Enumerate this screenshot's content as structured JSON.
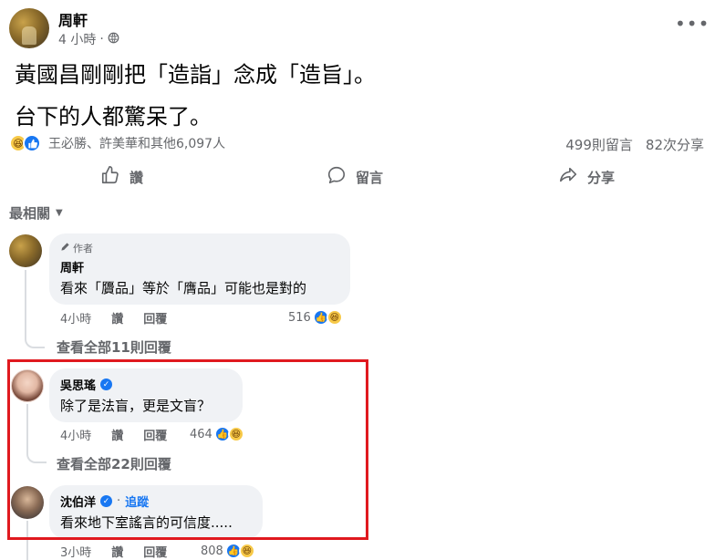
{
  "post": {
    "author": "周軒",
    "time": "4 小時",
    "meta_sep": "·",
    "line1": "黃國昌剛剛把「造詣」念成「造旨」。",
    "line2": "台下的人都驚呆了。",
    "reactors": "王必勝、許美華和其他6,097人",
    "comment_count": "499則留言",
    "share_count": "82次分享"
  },
  "actions": {
    "like": "讚",
    "comment": "留言",
    "share": "分享"
  },
  "sort_label": "最相關",
  "comments": [
    {
      "author_tag": "作者",
      "name": "周軒",
      "text": "看來「贗品」等於「膺品」可能也是對的",
      "time": "4小時",
      "like_label": "讚",
      "reply_label": "回覆",
      "reactions": "516",
      "view_replies": "查看全部11則回覆"
    },
    {
      "name": "吳思瑤",
      "text": "除了是法盲，更是文盲？",
      "time": "4小時",
      "like_label": "讚",
      "reply_label": "回覆",
      "reactions": "464",
      "view_replies": "查看全部22則回覆"
    },
    {
      "name": "沈伯洋",
      "follow": "追蹤",
      "text": "看來地下室謠言的可信度.....",
      "time": "3小時",
      "like_label": "讚",
      "reply_label": "回覆",
      "reactions": "808"
    }
  ],
  "colors": {
    "highlight": "#e0191f",
    "facebook_blue": "#1877f2",
    "muted_text": "#65676b",
    "bubble_bg": "#f0f2f5"
  }
}
